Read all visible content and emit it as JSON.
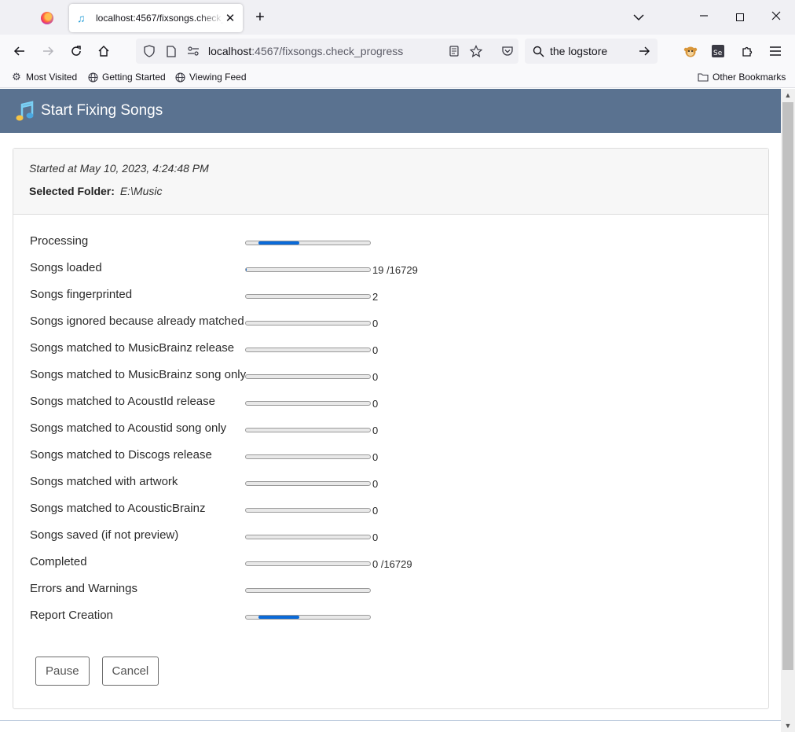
{
  "browser": {
    "inactive_tab_icon": "firefox-icon",
    "active_tab": {
      "title": "localhost:4567/fixsongs.check_progress",
      "favicon": "music-note-icon"
    },
    "url": {
      "host": "localhost",
      "rest": ":4567/fixsongs.check_progress"
    },
    "search_query": "the logstore",
    "bookmarks": [
      {
        "label": "Most Visited",
        "icon": "gear-icon"
      },
      {
        "label": "Getting Started",
        "icon": "globe-icon"
      },
      {
        "label": "Viewing Feed",
        "icon": "globe-icon"
      }
    ],
    "other_bookmarks": "Other Bookmarks"
  },
  "page": {
    "title": "Start Fixing Songs",
    "started_text": "Started at May 10, 2023, 4:24:48 PM",
    "folder_label": "Selected Folder:",
    "folder_value": "E:\\Music",
    "progress": [
      {
        "label": "Processing",
        "value": "",
        "indeterminate": true
      },
      {
        "label": "Songs loaded",
        "value": "19 /16729",
        "fraction": 0.001
      },
      {
        "label": "Songs fingerprinted",
        "value": "2",
        "fraction": 0
      },
      {
        "label": "Songs ignored because already matched",
        "value": "0",
        "fraction": 0
      },
      {
        "label": "Songs matched to MusicBrainz release",
        "value": "0",
        "fraction": 0
      },
      {
        "label": "Songs matched to MusicBrainz song only",
        "value": "0",
        "fraction": 0
      },
      {
        "label": "Songs matched to AcoustId release",
        "value": "0",
        "fraction": 0
      },
      {
        "label": "Songs matched to Acoustid song only",
        "value": "0",
        "fraction": 0
      },
      {
        "label": "Songs matched to Discogs release",
        "value": "0",
        "fraction": 0
      },
      {
        "label": "Songs matched with artwork",
        "value": "0",
        "fraction": 0
      },
      {
        "label": "Songs matched to AcousticBrainz",
        "value": "0",
        "fraction": 0
      },
      {
        "label": "Songs saved (if not preview)",
        "value": "0",
        "fraction": 0
      },
      {
        "label": "Completed",
        "value": "0 /16729",
        "fraction": 0
      },
      {
        "label": "Errors and Warnings",
        "value": "",
        "fraction": 0
      },
      {
        "label": "Report Creation",
        "value": "",
        "indeterminate": true
      }
    ],
    "buttons": {
      "pause": "Pause",
      "cancel": "Cancel"
    }
  },
  "colors": {
    "header_bg": "#5a7290",
    "progress_fill": "#0a6ad8"
  }
}
